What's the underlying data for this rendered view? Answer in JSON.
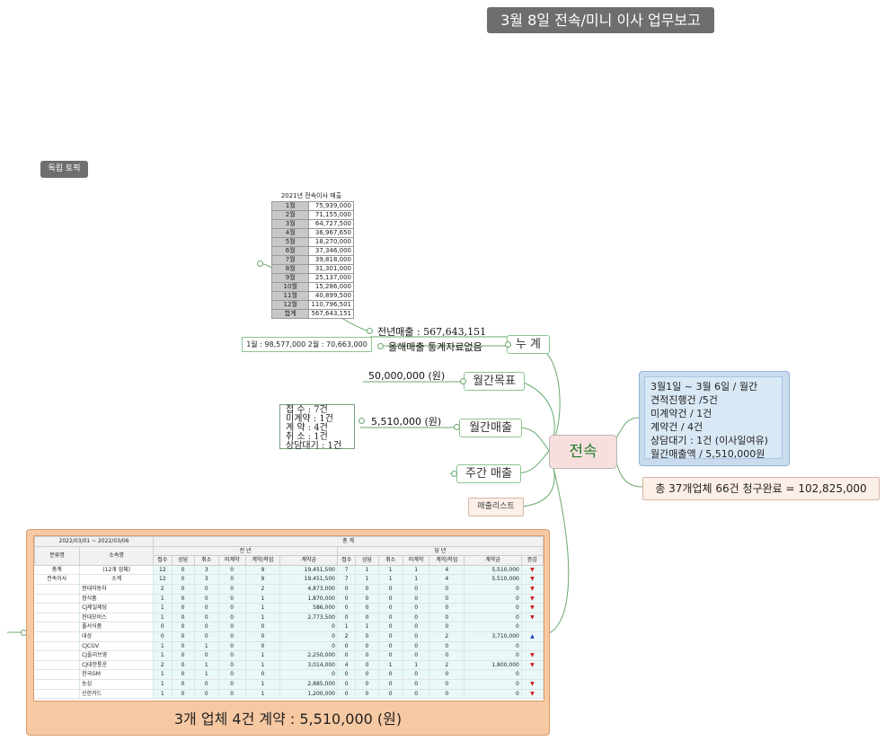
{
  "title": "3월  8일 전속/미니 이사 업무보고",
  "free_topic": "독립 토픽",
  "center": "전속",
  "branches": {
    "cumulative": "누 계",
    "monthly_target": "월간목표",
    "monthly_sales": "월간매출",
    "weekly_sales": "주간 매출",
    "sales_list": "매출리스트"
  },
  "cumulative": {
    "prev_year_sales": "전년매출 : 567,643,151",
    "this_year_note": "올해매출 통계자료없음",
    "monthly_line": "1월 : 98,577,000  2월 : 70,663,000"
  },
  "monthly_target_value": "50,000,000 (원)",
  "monthly_sales_value": "5,510,000 (원)",
  "counts": [
    "접    수 : 7건",
    "미계약 : 1건",
    "계    약 : 4건",
    "취    소 : 1건",
    "상담대기 : 1건"
  ],
  "summary": [
    "3월1일 ~ 3월 6일 / 월간",
    "견적진행건 /5건",
    "미계약건 / 1건",
    "계약건 / 4건",
    "상담대기 : 1건 (이사일여유)",
    "월간매출액 / 5,510,000원"
  ],
  "claim": "총 37개업체 66건 청구완료 = 102,825,000",
  "year_table": {
    "caption": "2021년 전속이사 매출",
    "rows": [
      [
        "1월",
        "75,939,000"
      ],
      [
        "2월",
        "71,155,000"
      ],
      [
        "3월",
        "64,727,500"
      ],
      [
        "4월",
        "36,967,650"
      ],
      [
        "5월",
        "18,270,000"
      ],
      [
        "6월",
        "37,346,000"
      ],
      [
        "7월",
        "39,818,000"
      ],
      [
        "8월",
        "31,301,000"
      ],
      [
        "9월",
        "25,137,000"
      ],
      [
        "10월",
        "15,286,000"
      ],
      [
        "11월",
        "40,899,500"
      ],
      [
        "12월",
        "110,796,501"
      ],
      [
        "합계",
        "567,643,151"
      ]
    ]
  },
  "detail": {
    "period": "2022/03/01 ~ 2022/03/06",
    "total_label": "총  계",
    "col_category": "분류명",
    "col_company": "소속명",
    "prev_year": "전          년",
    "this_year": "당          년",
    "sub_headers": [
      "접수",
      "상담",
      "취소",
      "미계약",
      "계약/착업",
      "계약금",
      "접수",
      "상담",
      "취소",
      "미계약",
      "계약/착업",
      "계약금",
      "증감"
    ],
    "rows": [
      [
        "총계",
        "(12개 업체)",
        "12",
        "0",
        "3",
        "0",
        "9",
        "19,451,500",
        "7",
        "1",
        "1",
        "1",
        "4",
        "5,510,000",
        "▼"
      ],
      [
        "전속이사",
        "소계",
        "12",
        "0",
        "3",
        "0",
        "9",
        "19,451,500",
        "7",
        "1",
        "1",
        "1",
        "4",
        "5,510,000",
        "▼"
      ],
      [
        "",
        "현대자동차",
        "2",
        "0",
        "0",
        "0",
        "2",
        "4,873,000",
        "0",
        "0",
        "0",
        "0",
        "0",
        "0",
        "▼"
      ],
      [
        "",
        "정식품",
        "1",
        "0",
        "0",
        "0",
        "1",
        "1,870,000",
        "0",
        "0",
        "0",
        "0",
        "0",
        "0",
        "▼"
      ],
      [
        "",
        "CJ제일제당",
        "1",
        "0",
        "0",
        "0",
        "1",
        "586,000",
        "0",
        "0",
        "0",
        "0",
        "0",
        "0",
        "▼"
      ],
      [
        "",
        "현대모비스",
        "1",
        "0",
        "0",
        "0",
        "1",
        "2,773,500",
        "0",
        "0",
        "0",
        "0",
        "0",
        "0",
        "▼"
      ],
      [
        "",
        "풀서식품",
        "0",
        "0",
        "0",
        "0",
        "0",
        "0",
        "1",
        "1",
        "0",
        "0",
        "0",
        "0",
        ""
      ],
      [
        "",
        "대상",
        "0",
        "0",
        "0",
        "0",
        "0",
        "0",
        "2",
        "0",
        "0",
        "0",
        "2",
        "3,710,000",
        "▲"
      ],
      [
        "",
        "CJCGV",
        "1",
        "0",
        "1",
        "0",
        "0",
        "0",
        "0",
        "0",
        "0",
        "0",
        "0",
        "0",
        ""
      ],
      [
        "",
        "CJ올리브영",
        "1",
        "0",
        "0",
        "0",
        "1",
        "2,250,000",
        "0",
        "0",
        "0",
        "0",
        "0",
        "0",
        "▼"
      ],
      [
        "",
        "CJ대한통운",
        "2",
        "0",
        "1",
        "0",
        "1",
        "3,014,000",
        "4",
        "0",
        "1",
        "1",
        "2",
        "1,800,000",
        "▼"
      ],
      [
        "",
        "한국GM",
        "1",
        "0",
        "1",
        "0",
        "0",
        "0",
        "0",
        "0",
        "0",
        "0",
        "0",
        "0",
        ""
      ],
      [
        "",
        "농심",
        "1",
        "0",
        "0",
        "0",
        "1",
        "2,885,000",
        "0",
        "0",
        "0",
        "0",
        "0",
        "0",
        "▼"
      ],
      [
        "",
        "신한카드",
        "1",
        "0",
        "0",
        "0",
        "1",
        "1,200,000",
        "0",
        "0",
        "0",
        "0",
        "0",
        "0",
        "▼"
      ]
    ],
    "footer": "3개 업체  4건 계약 : 5,510,000 (원)"
  },
  "colors": {
    "line": "#68a86d",
    "accent_green": "#1d7a2a",
    "up": "#1f3fbf",
    "down": "#d01616"
  }
}
